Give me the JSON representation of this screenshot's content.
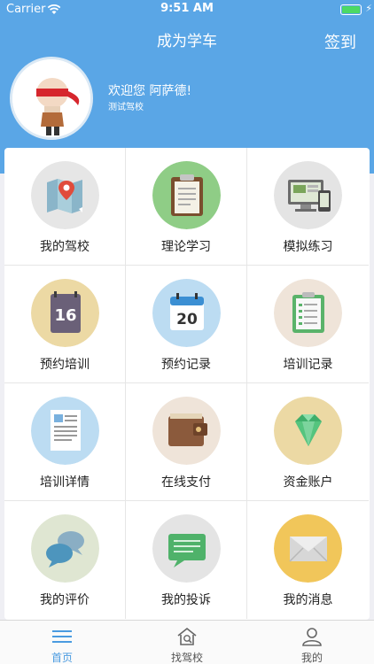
{
  "status": {
    "carrier": "Carrier",
    "time": "9:51 AM",
    "battery_color": "#4cd964"
  },
  "header": {
    "title": "成为学车",
    "checkin_label": "签到",
    "welcome": "欢迎您 阿萨德!",
    "school": "测试驾校",
    "background": "#5aa6e6"
  },
  "grid": {
    "items": [
      {
        "label": "我的驾校",
        "icon": "map-icon"
      },
      {
        "label": "理论学习",
        "icon": "clipboard-icon"
      },
      {
        "label": "模拟练习",
        "icon": "computer-icon"
      },
      {
        "label": "预约培训",
        "icon": "calendar-icon",
        "day": "16"
      },
      {
        "label": "预约记录",
        "icon": "calendar-icon",
        "day": "20"
      },
      {
        "label": "培训记录",
        "icon": "checklist-icon"
      },
      {
        "label": "培训详情",
        "icon": "document-icon"
      },
      {
        "label": "在线支付",
        "icon": "wallet-icon"
      },
      {
        "label": "资金账户",
        "icon": "gem-icon"
      },
      {
        "label": "我的评价",
        "icon": "chat-bubbles-icon"
      },
      {
        "label": "我的投诉",
        "icon": "message-icon"
      },
      {
        "label": "我的消息",
        "icon": "envelope-icon"
      }
    ]
  },
  "tabbar": {
    "tabs": [
      {
        "label": "首页",
        "icon": "menu-icon",
        "active": true
      },
      {
        "label": "找驾校",
        "icon": "house-search-icon",
        "active": false
      },
      {
        "label": "我的",
        "icon": "person-icon",
        "active": false
      }
    ],
    "active_color": "#4a9be0"
  }
}
